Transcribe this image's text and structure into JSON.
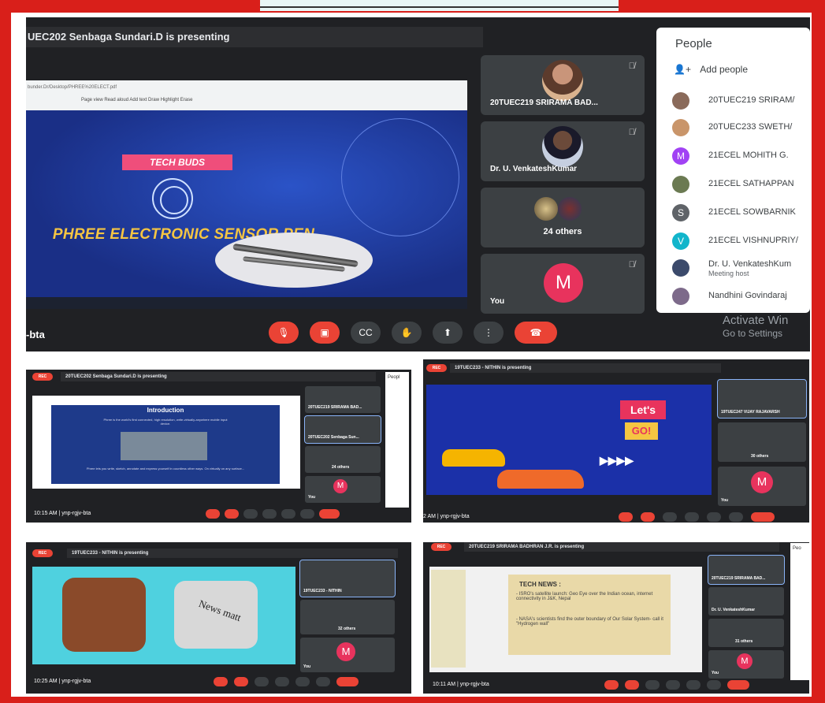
{
  "main": {
    "presenting_text": "UEC202 Senbaga Sundari.D is presenting",
    "browser": {
      "url": "bunder.Dr/Desktop/PHREE%20ELECT.pdf",
      "toolbar": "Page view    Read aloud    Add text    Draw    Highlight    Erase"
    },
    "slide": {
      "badge": "TECH BUDS",
      "title": "PHREE ELECTRONIC SENSOR PEN"
    },
    "tiles": [
      {
        "name": "20TUEC219 SRIRAMA BAD..."
      },
      {
        "name": "Dr. U. VenkateshKumar"
      },
      {
        "name": "24 others"
      },
      {
        "name": "You",
        "initial": "M"
      }
    ],
    "people": {
      "title": "People",
      "add_label": "Add people",
      "list": [
        {
          "name": "20TUEC219 SRIRAM/",
          "color": "#8a6a5a"
        },
        {
          "name": "20TUEC233 SWETH/",
          "color": "#c9956a"
        },
        {
          "name": "21ECEL MOHITH G.",
          "initial": "M",
          "color": "#a142f4"
        },
        {
          "name": "21ECEL SATHAPPAN",
          "color": "#6b7a52"
        },
        {
          "name": "21ECEL SOWBARNIK",
          "initial": "S",
          "color": "#5f6368"
        },
        {
          "name": "21ECEL VISHNUPRIY/",
          "initial": "V",
          "color": "#12b5cb"
        },
        {
          "name": "Dr. U. VenkateshKum",
          "sub": "Meeting host",
          "color": "#3b4a6b"
        },
        {
          "name": "Nandhini Govindaraj",
          "color": "#7d6a8a"
        }
      ]
    },
    "meeting_code": "-bta",
    "activate_line1": "Activate Win",
    "activate_line2": "Go to Settings"
  },
  "shot_a": {
    "presenting": "20TUEC202 Senbaga Sundari.D is presenting",
    "slide_title": "Introduction",
    "slide_body": "Phree is the world's first connected, high resolution, write-virtually-anywhere mobile input device.",
    "slide_body2": "Phree lets you write, sketch, annotate and express yourself in countless other ways. On virtually on any surface...",
    "tile1": "20TUEC219 SRIRAMA BAD...",
    "tile2": "20TUEC202 Senbaga Sun...",
    "tile3": "24 others",
    "tile4": "You",
    "footer": "10:15 AM  |  ynp-rgjv-bta",
    "people_label": "Peopl"
  },
  "shot_b": {
    "presenting": "19TUEC233 - NITHIN is presenting",
    "tile1": "19TUEC247 VIJAY RAJAVARSH",
    "tile2": "30 others",
    "tile3": "You",
    "slide_text1": "Let's",
    "slide_text2": "GO!",
    "footer": "2 AM  |  ynp-rgjv-bta"
  },
  "shot_c": {
    "presenting": "19TUEC233 - NITHIN is presenting",
    "tile1": "19TUEC233 - NITHIN",
    "tile2": "32 others",
    "tile3": "You",
    "news_text": "News matt",
    "footer": "10:25 AM  |  ynp-rgjv-bta"
  },
  "shot_d": {
    "presenting": "20TUEC219 SRIRAMA BADHRAN J.R. is presenting",
    "slide_heading": "TECH NEWS :",
    "bullet1": "- ISRO's satellite launch: Geo Eye over the Indian ocean, internet connectivity in J&K, Nepal",
    "bullet2": "- NASA's scientists find the outer boundary of Our Solar System- call it \"Hydrogen wall\"",
    "tile1": "20TUEC219 SRIRAMA BAD...",
    "tile2": "Dr. U. VenkateshKumar",
    "tile3": "31 others",
    "tile4": "You",
    "footer": "10:11 AM  |  ynp-rgjv-bta",
    "people_label": "Peo"
  },
  "rec_label": "REC",
  "you_initial": "M",
  "colors": {
    "frame": "#d91f1a",
    "meet_bg": "#202124",
    "end_call": "#ea4335",
    "avatar_m": "#e8335d"
  }
}
